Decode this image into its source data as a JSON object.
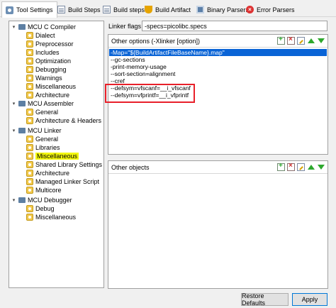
{
  "tabs": [
    {
      "label": "Tool Settings",
      "icon": "settings-icon",
      "active": true
    },
    {
      "label": "Build Steps",
      "icon": "page-icon"
    },
    {
      "label": "Build steps",
      "icon": "page-icon"
    },
    {
      "label": "Build Artifact",
      "icon": "trophy-icon"
    },
    {
      "label": "Binary Parsers",
      "icon": "grid-icon"
    },
    {
      "label": "Error Parsers",
      "icon": "error-icon"
    }
  ],
  "tree": [
    {
      "label": "MCU C Compiler",
      "level": 0,
      "expanded": true
    },
    {
      "label": "Dialect",
      "level": 1
    },
    {
      "label": "Preprocessor",
      "level": 1
    },
    {
      "label": "Includes",
      "level": 1
    },
    {
      "label": "Optimization",
      "level": 1
    },
    {
      "label": "Debugging",
      "level": 1
    },
    {
      "label": "Warnings",
      "level": 1
    },
    {
      "label": "Miscellaneous",
      "level": 1
    },
    {
      "label": "Architecture",
      "level": 1
    },
    {
      "label": "MCU Assembler",
      "level": 0,
      "expanded": true
    },
    {
      "label": "General",
      "level": 1
    },
    {
      "label": "Architecture & Headers",
      "level": 1
    },
    {
      "label": "MCU Linker",
      "level": 0,
      "expanded": true
    },
    {
      "label": "General",
      "level": 1
    },
    {
      "label": "Libraries",
      "level": 1
    },
    {
      "label": "Miscellaneous",
      "level": 1,
      "highlighted": true
    },
    {
      "label": "Shared Library Settings",
      "level": 1
    },
    {
      "label": "Architecture",
      "level": 1
    },
    {
      "label": "Managed Linker Script",
      "level": 1
    },
    {
      "label": "Multicore",
      "level": 1
    },
    {
      "label": "MCU Debugger",
      "level": 0,
      "expanded": true
    },
    {
      "label": "Debug",
      "level": 1
    },
    {
      "label": "Miscellaneous",
      "level": 1
    }
  ],
  "linker_flags": {
    "label": "Linker flags",
    "value": "-specs=picolibc.specs"
  },
  "other_options": {
    "title": "Other options (-Xlinker [option])",
    "items": [
      "-Map=\"${BuildArtifactFileBaseName}.map\"",
      "--gc-sections",
      "-print-memory-usage",
      "--sort-section=alignment",
      "--cref",
      "--defsym=vfscanf=__i_vfscanf",
      "--defsym=vfprintf=__i_vfprintf"
    ],
    "selected_index": 0
  },
  "other_objects": {
    "title": "Other objects",
    "items": []
  },
  "buttons": {
    "restore": "Restore Defaults",
    "apply": "Apply"
  },
  "colors": {
    "selection": "#0a64d6",
    "highlight": "#f3f70e",
    "annotation_box": "#e8202a"
  }
}
